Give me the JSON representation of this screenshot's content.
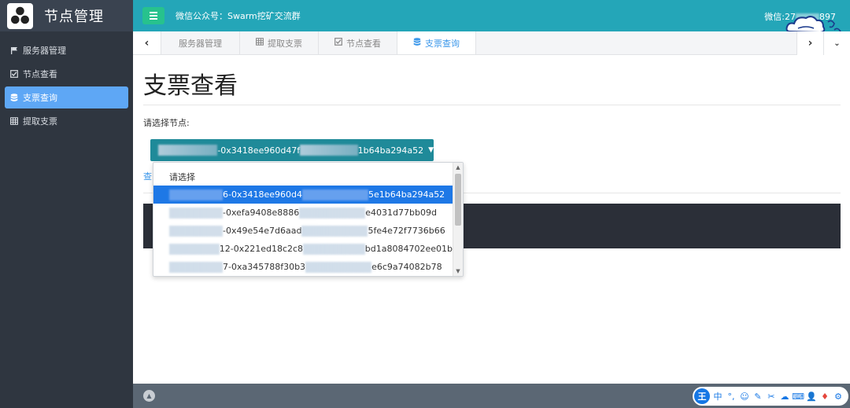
{
  "brand": {
    "title": "节点管理"
  },
  "sidebar": {
    "items": [
      {
        "label": "服务器管理",
        "icon": "flag-icon",
        "active": false
      },
      {
        "label": "节点查看",
        "icon": "check-square-icon",
        "active": false
      },
      {
        "label": "支票查询",
        "icon": "database-icon",
        "active": true
      },
      {
        "label": "提取支票",
        "icon": "table-icon",
        "active": false
      }
    ]
  },
  "topbar": {
    "wechat_public": "微信公众号：Swarm挖矿交流群",
    "wechat_contact": "微信:27",
    "wechat_contact_tail": "897"
  },
  "tabs": [
    {
      "label": "服务器管理",
      "icon": "",
      "active": false
    },
    {
      "label": "提取支票",
      "icon": "table-icon",
      "active": false
    },
    {
      "label": "节点查看",
      "icon": "check-square-icon",
      "active": false
    },
    {
      "label": "支票查询",
      "icon": "database-icon",
      "active": true
    }
  ],
  "main": {
    "title": "支票查看",
    "select_label": "请选择节点:",
    "selected_value_prefix": "-0x3418ee960d47f",
    "selected_value_suffix": "1b64ba294a52",
    "query_link": "查"
  },
  "dropdown": {
    "placeholder": "请选择",
    "options": [
      {
        "prefix": "6-0x3418ee960d4",
        "suffix": "5e1b64ba294a52",
        "selected": true
      },
      {
        "prefix": "-0xefa9408e8886",
        "suffix": "e4031d77bb09d",
        "selected": false
      },
      {
        "prefix": "-0x49e54e7d6aad",
        "suffix": "5fe4e72f7736b66",
        "selected": false
      },
      {
        "prefix": "12-0x221ed18c2c8",
        "suffix": "bd1a8084702ee01b",
        "selected": false
      },
      {
        "prefix": "7-0xa345788f30b3",
        "suffix": "e6c9a74082b78",
        "selected": false
      }
    ]
  },
  "colors": {
    "sidebar_bg": "#2f3640",
    "topbar_bg": "#24a6b8",
    "accent_green": "#27c28d",
    "active_blue": "#5ea7f5",
    "select_bg": "#1f8a99",
    "selected_option": "#1e78e6"
  },
  "ime": {
    "logo": "王",
    "lang": "中"
  }
}
